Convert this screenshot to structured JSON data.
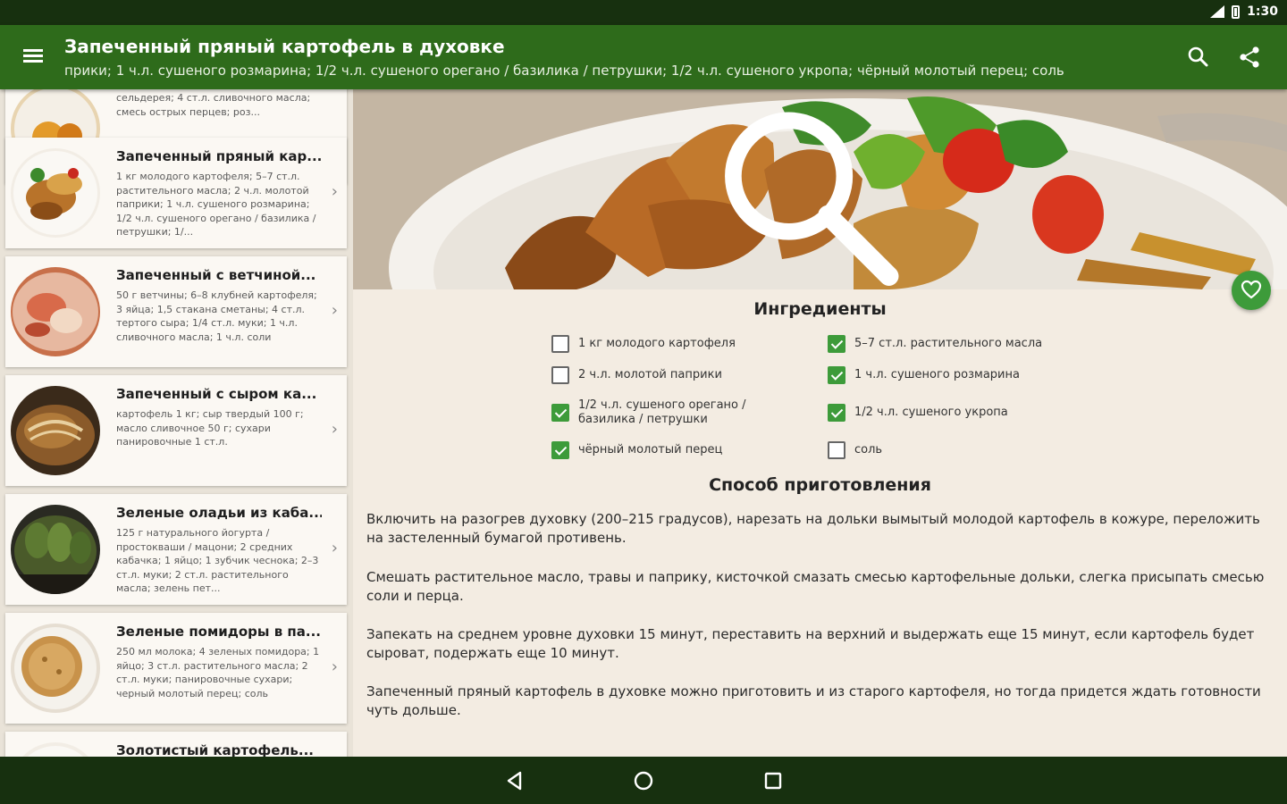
{
  "status_bar": {
    "time": "1:30"
  },
  "toolbar": {
    "title": "Запеченный пряный картофель в духовке",
    "subtitle": "прики; 1 ч.л. сушеного розмарина; 1/2 ч.л. сушеного орегано / базилика / петрушки; 1/2 ч.л. сушеного укропа; чёрный молотый перец; соль"
  },
  "recipes": [
    {
      "title": "",
      "desc": "сельдерея; 4 ст.л. сливочного масла; смесь острых перцев; роз...",
      "thumb": "potato-dish"
    },
    {
      "title": "Запеченный пряный кар...",
      "desc": "1 кг молодого картофеля; 5–7 ст.л. растительного масла; 2 ч.л. молотой паприки; 1 ч.л. сушеного розмарина; 1/2 ч.л. сушеного орегано / базилика / петрушки; 1/...",
      "thumb": "potato-wedges"
    },
    {
      "title": "Запеченный с ветчиной...",
      "desc": "50 г ветчины; 6–8 клубней картофеля; 3 яйца; 1,5 стакана сметаны; 4 ст.л. тертого сыра; 1/4 ст.л. муки; 1 ч.л. сливочного масла; 1 ч.л. соли",
      "thumb": "ham-casserole"
    },
    {
      "title": "Запеченный с сыром ка...",
      "desc": "картофель 1 кг; сыр твердый 100 г; масло сливочное 50 г; сухари панировочные 1 ст.л.",
      "thumb": "cheese-potato"
    },
    {
      "title": "Зеленые оладьи из каба...",
      "desc": "125 г натурального йогурта / простокваши / мацони; 2 средних кабачка; 1 яйцо; 1 зубчик чеснока; 2–3 ст.л. муки; 2 ст.л. растительного масла; зелень пет...",
      "thumb": "zucchini-fritters"
    },
    {
      "title": "Зеленые помидоры в па...",
      "desc": "250 мл молока; 4 зеленых помидора; 1 яйцо; 3 ст.л. растительного масла; 2 ст.л. муки; панировочные сухари; черный молотый перец; соль",
      "thumb": "breaded-tomatoes"
    },
    {
      "title": "Золотистый картофель...",
      "desc": "",
      "thumb": "golden-potato"
    }
  ],
  "ingredients": {
    "title": "Ингредиенты",
    "items": [
      {
        "label": "1 кг молодого картофеля",
        "checked": false
      },
      {
        "label": "5–7 ст.л. растительного масла",
        "checked": true
      },
      {
        "label": "2 ч.л. молотой паприки",
        "checked": false
      },
      {
        "label": "1 ч.л. сушеного розмарина",
        "checked": true
      },
      {
        "label": "1/2 ч.л. сушеного орегано / базилика / петрушки",
        "checked": true
      },
      {
        "label": "1/2 ч.л. сушеного укропа",
        "checked": true
      },
      {
        "label": "чёрный молотый перец",
        "checked": true
      },
      {
        "label": "соль",
        "checked": false
      }
    ]
  },
  "method": {
    "title": "Способ приготовления",
    "steps": [
      "Включить на разогрев духовку (200–215 градусов), нарезать на дольки вымытый молодой картофель в кожуре, переложить на застеленный бумагой противень.",
      "Смешать растительное масло, травы и паприку, кисточкой смазать смесью картофельные дольки, слегка присыпать смесью соли и перца.",
      "Запекать на среднем уровне духовки 15 минут, переставить на верхний и выдержать еще 15 минут, если картофель будет сыроват, подержать еще 10 минут.",
      "Запеченный пряный картофель в духовке можно приготовить и из старого картофеля, но тогда придется ждать готовности чуть дольше."
    ]
  },
  "colors": {
    "toolbar": "#2e6b1b",
    "status": "#17300f",
    "accent": "#3d9b3a",
    "background": "#f3ece2"
  },
  "icons": [
    "menu-icon",
    "search-icon",
    "share-icon",
    "zoom-icon",
    "heart-icon",
    "back-icon",
    "home-icon",
    "recents-icon"
  ]
}
